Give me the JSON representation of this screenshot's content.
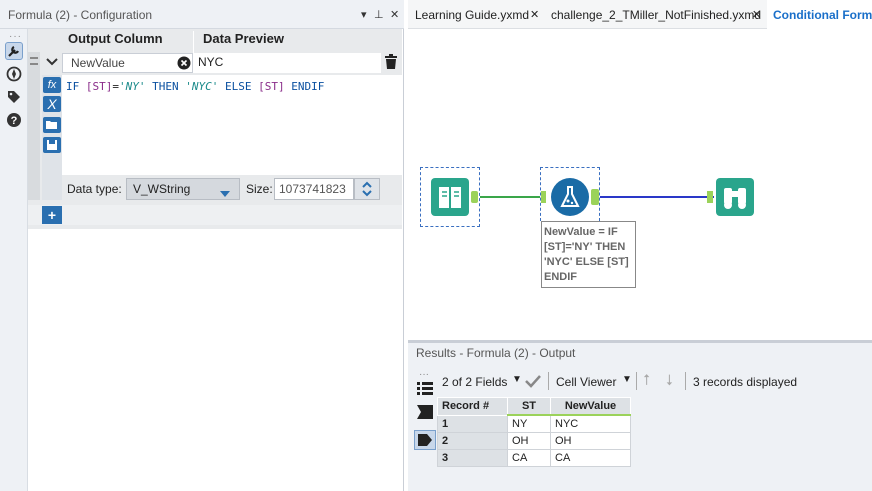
{
  "config": {
    "title": "Formula (2) - Configuration",
    "controls": {
      "dropdown": "▾",
      "pin": "⊥",
      "close": "✕"
    },
    "columns": {
      "output": "Output Column",
      "preview": "Data Preview"
    },
    "row": {
      "name": "NewValue",
      "preview": "NYC"
    },
    "expression": {
      "kw_if": "IF",
      "field1": "[ST]",
      "eq": "=",
      "str1": "'NY'",
      "kw_then": "THEN",
      "str2": "'NYC'",
      "kw_else": "ELSE",
      "field2": "[ST]",
      "kw_endif": "ENDIF"
    },
    "datatype_label": "Data type:",
    "datatype_value": "V_WString",
    "size_label": "Size:",
    "size_value": "1073741823"
  },
  "tabs": [
    {
      "label": "Learning Guide.yxmd"
    },
    {
      "label": "challenge_2_TMiller_NotFinished.yxmd"
    },
    {
      "label": "Conditional Formu"
    }
  ],
  "canvas": {
    "annotation": "NewValue = IF [ST]='NY' THEN 'NYC' ELSE [ST] ENDIF",
    "annotation_lines": [
      "NewValue = IF",
      "[ST]='NY' THEN",
      "'NYC' ELSE [ST]",
      "ENDIF"
    ],
    "colors": {
      "input_tool": "#2aa58c",
      "formula_tool": "#1a6ba6",
      "browse_tool": "#2aa58c",
      "connector_green": "#3aa64a",
      "connector_blue": "#2a38c8"
    }
  },
  "results": {
    "title": "Results - Formula (2) - Output",
    "fields": "2 of 2 Fields",
    "viewer": "Cell Viewer",
    "records": "3 records displayed",
    "headers": [
      "Record #",
      "ST",
      "NewValue"
    ],
    "rows": [
      [
        "1",
        "NY",
        "NYC"
      ],
      [
        "2",
        "OH",
        "OH"
      ],
      [
        "3",
        "CA",
        "CA"
      ]
    ]
  },
  "icons": [
    "wrench-icon",
    "globe-icon",
    "tag-icon",
    "help-icon",
    "fx-icon",
    "variable-icon",
    "folder-icon",
    "save-icon",
    "trash-icon",
    "clear-icon",
    "add-icon",
    "input-data-icon",
    "formula-icon",
    "browse-icon",
    "list-icon",
    "checkmark-icon",
    "up-arrow-icon",
    "down-arrow-icon"
  ]
}
